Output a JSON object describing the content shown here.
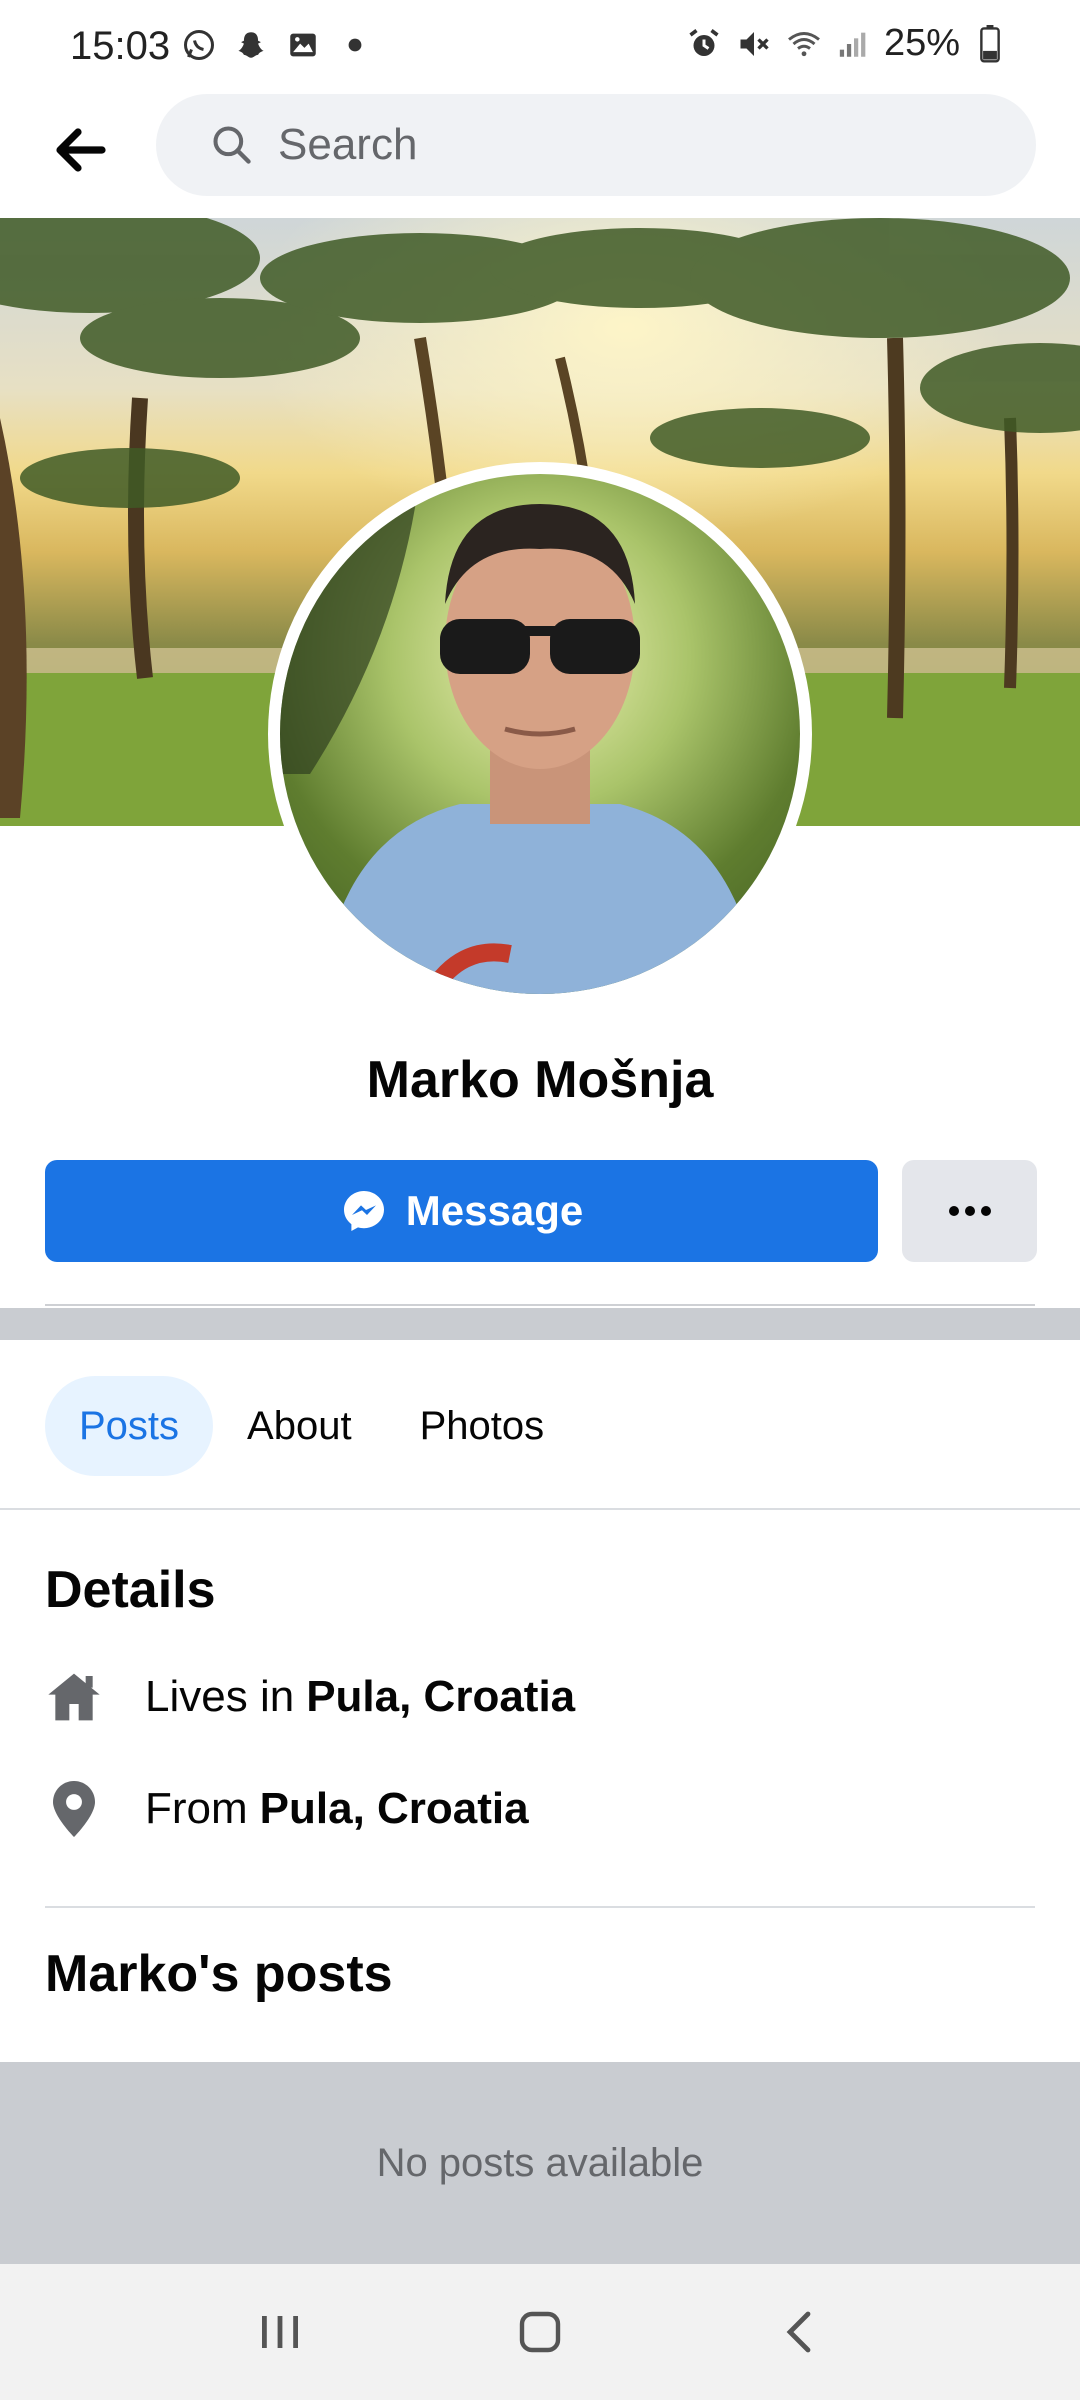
{
  "status_bar": {
    "time": "15:03",
    "left_icons": [
      "whatsapp-icon",
      "snapchat-icon",
      "gallery-icon",
      "dot-icon"
    ],
    "right_icons": [
      "alarm-icon",
      "mute-icon",
      "wifi-icon",
      "signal-icon"
    ],
    "battery": "25%"
  },
  "top_nav": {
    "back_icon": "back-arrow-icon",
    "search_placeholder": "Search"
  },
  "profile": {
    "name": "Marko Mošnja",
    "message_label": "Message",
    "more_icon": "more-icon"
  },
  "tabs": [
    {
      "label": "Posts",
      "active": true
    },
    {
      "label": "About",
      "active": false
    },
    {
      "label": "Photos",
      "active": false
    }
  ],
  "details": {
    "title": "Details",
    "lives": {
      "prefix": "Lives in",
      "place": "Pula, Croatia",
      "icon": "home-icon"
    },
    "from": {
      "prefix": "From",
      "place": "Pula, Croatia",
      "icon": "location-pin-icon"
    }
  },
  "posts": {
    "title": "Marko's posts",
    "empty_text": "No posts available"
  },
  "colors": {
    "brand": "#1b74e4",
    "tab_active_bg": "#e7f3ff",
    "separator": "#c9ccd1"
  }
}
